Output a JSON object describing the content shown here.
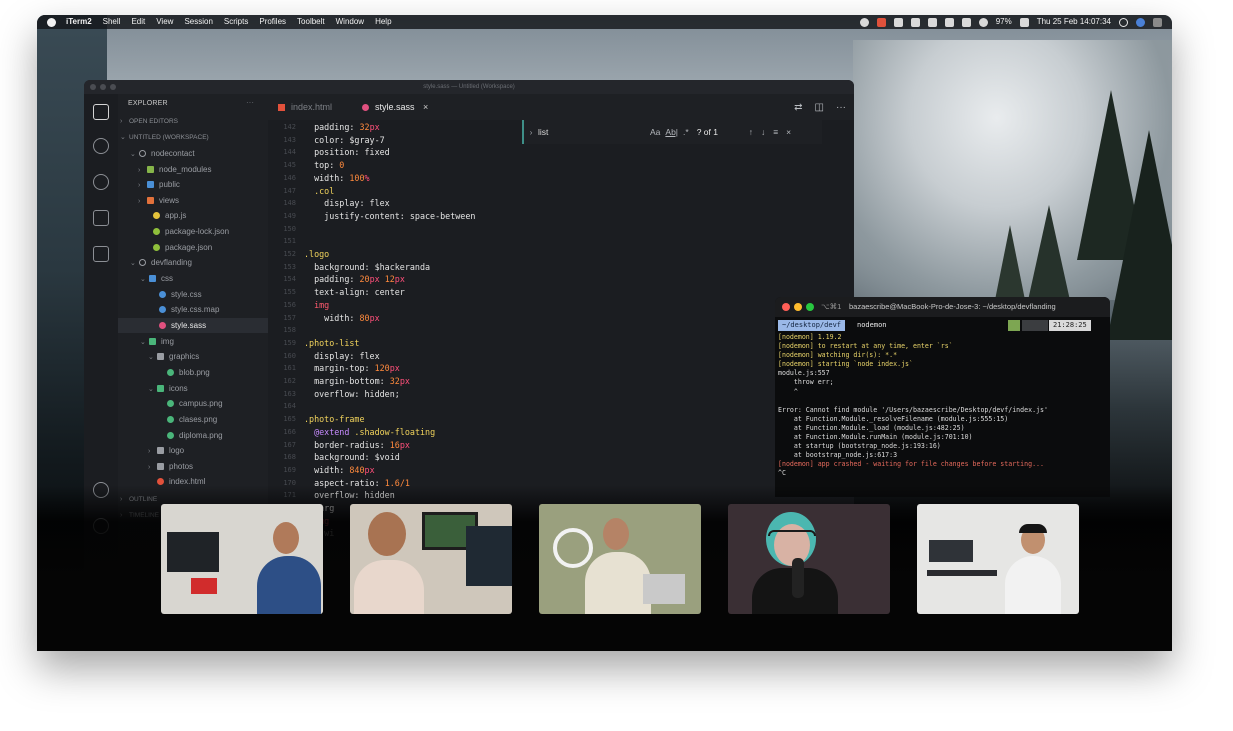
{
  "menubar": {
    "app": "iTerm2",
    "items": [
      "Shell",
      "Edit",
      "View",
      "Session",
      "Scripts",
      "Profiles",
      "Toolbelt",
      "Window",
      "Help"
    ],
    "battery": "97%",
    "clock": "Thu 25 Feb  14:07:34"
  },
  "vscode": {
    "title": "style.sass — Untitled (Workspace)",
    "explorer_label": "EXPLORER",
    "explorer_menu": "···",
    "tree": [
      {
        "label": "OPEN EDITORS",
        "kind": "section",
        "chevron": "›",
        "color": "#8b8e94"
      },
      {
        "label": "UNTITLED (WORKSPACE)",
        "kind": "section",
        "chevron": "⌄",
        "color": "#8b8e94"
      },
      {
        "label": "nodecontact",
        "kind": "root",
        "chevron": "⌄",
        "color": "#9a9da3"
      },
      {
        "label": "node_modules",
        "kind": "folder",
        "chevron": "›",
        "color": "#86b54a"
      },
      {
        "label": "public",
        "kind": "folder",
        "chevron": "›",
        "color": "#4a8fd6"
      },
      {
        "label": "views",
        "kind": "folder",
        "chevron": "›",
        "color": "#e2713b"
      },
      {
        "label": "app.js",
        "kind": "file",
        "chevron": "",
        "color": "#e4c23b"
      },
      {
        "label": "package-lock.json",
        "kind": "file",
        "chevron": "",
        "color": "#8fbf3b"
      },
      {
        "label": "package.json",
        "kind": "file",
        "chevron": "",
        "color": "#8fbf3b"
      },
      {
        "label": "devflanding",
        "kind": "root",
        "chevron": "⌄",
        "color": "#9a9da3"
      },
      {
        "label": "css",
        "kind": "folder",
        "chevron": "⌄",
        "color": "#4a8fd6"
      },
      {
        "label": "style.css",
        "kind": "file",
        "chevron": "",
        "color": "#4a8fd6"
      },
      {
        "label": "style.css.map",
        "kind": "file",
        "chevron": "",
        "color": "#4a8fd6"
      },
      {
        "label": "style.sass",
        "kind": "file",
        "chevron": "",
        "color": "#e0507f"
      },
      {
        "label": "img",
        "kind": "folder",
        "chevron": "⌄",
        "color": "#4ab57a"
      },
      {
        "label": "graphics",
        "kind": "folder",
        "chevron": "⌄",
        "color": "#9a9da3"
      },
      {
        "label": "blob.png",
        "kind": "file",
        "chevron": "",
        "color": "#4ab57a"
      },
      {
        "label": "icons",
        "kind": "folder",
        "chevron": "⌄",
        "color": "#4ab57a"
      },
      {
        "label": "campus.png",
        "kind": "file",
        "chevron": "",
        "color": "#4ab57a"
      },
      {
        "label": "clases.png",
        "kind": "file",
        "chevron": "",
        "color": "#4ab57a"
      },
      {
        "label": "diploma.png",
        "kind": "file",
        "chevron": "",
        "color": "#4ab57a"
      },
      {
        "label": "logo",
        "kind": "folder",
        "chevron": "›",
        "color": "#9a9da3"
      },
      {
        "label": "photos",
        "kind": "folder",
        "chevron": "›",
        "color": "#9a9da3"
      },
      {
        "label": "index.html",
        "kind": "file",
        "chevron": "",
        "color": "#e2513b"
      },
      {
        "label": "OUTLINE",
        "kind": "section",
        "chevron": "›",
        "color": "#6b6e74"
      },
      {
        "label": "TIMELINE",
        "kind": "section",
        "chevron": "›",
        "color": "#6b6e74"
      }
    ],
    "tabs": [
      {
        "label": "index.html",
        "color": "#e2513b",
        "active": false
      },
      {
        "label": "style.sass",
        "color": "#e0507f",
        "active": true
      }
    ],
    "close_glyph": "×",
    "find": {
      "query": "list",
      "aa": "Aa",
      "ab": "Ab|",
      "regex": ".*",
      "count": "? of 1"
    },
    "code": [
      {
        "n": "142",
        "segs": [
          {
            "t": "  padding: ",
            "c": "#e4e4e4"
          },
          {
            "t": "32",
            "c": "#ff8a3d"
          },
          {
            "t": "px",
            "c": "#ff4f7a"
          }
        ]
      },
      {
        "n": "143",
        "segs": [
          {
            "t": "  color: $gray-7",
            "c": "#e4e4e4"
          }
        ]
      },
      {
        "n": "144",
        "segs": [
          {
            "t": "  position: fixed",
            "c": "#e4e4e4"
          }
        ]
      },
      {
        "n": "145",
        "segs": [
          {
            "t": "  top: ",
            "c": "#e4e4e4"
          },
          {
            "t": "0",
            "c": "#ff8a3d"
          }
        ]
      },
      {
        "n": "146",
        "segs": [
          {
            "t": "  width: ",
            "c": "#e4e4e4"
          },
          {
            "t": "100",
            "c": "#ff8a3d"
          },
          {
            "t": "%",
            "c": "#ff4f7a"
          }
        ]
      },
      {
        "n": "147",
        "segs": [
          {
            "t": "  .col",
            "c": "#f1d35c"
          }
        ]
      },
      {
        "n": "148",
        "segs": [
          {
            "t": "    display: flex",
            "c": "#e4e4e4"
          }
        ]
      },
      {
        "n": "149",
        "segs": [
          {
            "t": "    justify-content: space-between",
            "c": "#e4e4e4"
          }
        ]
      },
      {
        "n": "150",
        "segs": []
      },
      {
        "n": "151",
        "segs": []
      },
      {
        "n": "152",
        "segs": [
          {
            "t": ".logo",
            "c": "#f1d35c"
          }
        ]
      },
      {
        "n": "153",
        "segs": [
          {
            "t": "  background: $hackeranda",
            "c": "#e4e4e4"
          }
        ]
      },
      {
        "n": "154",
        "segs": [
          {
            "t": "  padding: ",
            "c": "#e4e4e4"
          },
          {
            "t": "20",
            "c": "#ff8a3d"
          },
          {
            "t": "px ",
            "c": "#ff4f7a"
          },
          {
            "t": "12",
            "c": "#ff8a3d"
          },
          {
            "t": "px",
            "c": "#ff4f7a"
          }
        ]
      },
      {
        "n": "155",
        "segs": [
          {
            "t": "  text-align: center",
            "c": "#e4e4e4"
          }
        ]
      },
      {
        "n": "156",
        "segs": [
          {
            "t": "  img",
            "c": "#ff5a6e"
          }
        ]
      },
      {
        "n": "157",
        "segs": [
          {
            "t": "    width: ",
            "c": "#e4e4e4"
          },
          {
            "t": "80",
            "c": "#ff8a3d"
          },
          {
            "t": "px",
            "c": "#ff4f7a"
          }
        ]
      },
      {
        "n": "158",
        "segs": []
      },
      {
        "n": "159",
        "segs": [
          {
            "t": ".photo-list",
            "c": "#f1d35c"
          }
        ]
      },
      {
        "n": "160",
        "segs": [
          {
            "t": "  display: flex",
            "c": "#e4e4e4"
          }
        ]
      },
      {
        "n": "161",
        "segs": [
          {
            "t": "  margin-top: ",
            "c": "#e4e4e4"
          },
          {
            "t": "120",
            "c": "#ff8a3d"
          },
          {
            "t": "px",
            "c": "#ff4f7a"
          }
        ]
      },
      {
        "n": "162",
        "segs": [
          {
            "t": "  margin-bottom: ",
            "c": "#e4e4e4"
          },
          {
            "t": "32",
            "c": "#ff8a3d"
          },
          {
            "t": "px",
            "c": "#ff4f7a"
          }
        ]
      },
      {
        "n": "163",
        "segs": [
          {
            "t": "  overflow: hidden;",
            "c": "#e4e4e4"
          }
        ]
      },
      {
        "n": "164",
        "segs": []
      },
      {
        "n": "165",
        "segs": [
          {
            "t": ".photo-frame",
            "c": "#f1d35c"
          }
        ]
      },
      {
        "n": "166",
        "segs": [
          {
            "t": "  @extend",
            "c": "#c78bff"
          },
          {
            "t": " .shadow-floating",
            "c": "#f1d35c"
          }
        ]
      },
      {
        "n": "167",
        "segs": [
          {
            "t": "  border-radius: ",
            "c": "#e4e4e4"
          },
          {
            "t": "16",
            "c": "#ff8a3d"
          },
          {
            "t": "px",
            "c": "#ff4f7a"
          }
        ]
      },
      {
        "n": "168",
        "segs": [
          {
            "t": "  background: $void",
            "c": "#e4e4e4"
          }
        ]
      },
      {
        "n": "169",
        "segs": [
          {
            "t": "  width: ",
            "c": "#e4e4e4"
          },
          {
            "t": "840",
            "c": "#ff8a3d"
          },
          {
            "t": "px",
            "c": "#ff4f7a"
          }
        ]
      },
      {
        "n": "170",
        "segs": [
          {
            "t": "  aspect-ratio: ",
            "c": "#e4e4e4"
          },
          {
            "t": "1.6/1",
            "c": "#ff8a3d"
          }
        ]
      },
      {
        "n": "171",
        "segs": [
          {
            "t": "  overflow: hidden",
            "c": "#e4e4e4"
          }
        ]
      },
      {
        "n": "172",
        "segs": [
          {
            "t": "  marg",
            "c": "#e4e4e4"
          }
        ]
      },
      {
        "n": "173",
        "segs": [
          {
            "t": "  img",
            "c": "#ff5a6e"
          }
        ]
      },
      {
        "n": "174",
        "segs": [
          {
            "t": "    wi",
            "c": "#e4e4e4"
          }
        ]
      }
    ]
  },
  "iterm": {
    "title": "bazaescribe@MacBook-Pro-de-Jose-3: ~/desktop/devflanding",
    "shortcut": "⌥⌘1",
    "prompt_dir": "~/desktop/devf",
    "prompt_cmd": "nodemon",
    "clock": "21:28:25",
    "lines": [
      {
        "t": "[nodemon] 1.19.2",
        "c": "yellow"
      },
      {
        "t": "[nodemon] to restart at any time, enter `rs`",
        "c": "yellow"
      },
      {
        "t": "[nodemon] watching dir(s): *.*",
        "c": "yellow"
      },
      {
        "t": "[nodemon] starting `node index.js`",
        "c": "yellow"
      },
      {
        "t": "module.js:557",
        "c": "white"
      },
      {
        "t": "    throw err;",
        "c": "white"
      },
      {
        "t": "    ^",
        "c": "white"
      },
      {
        "t": "",
        "c": "white"
      },
      {
        "t": "Error: Cannot find module '/Users/bazaescribe/Desktop/devf/index.js'",
        "c": "white"
      },
      {
        "t": "    at Function.Module._resolveFilename (module.js:555:15)",
        "c": "white"
      },
      {
        "t": "    at Function.Module._load (module.js:482:25)",
        "c": "white"
      },
      {
        "t": "    at Function.Module.runMain (module.js:701:10)",
        "c": "white"
      },
      {
        "t": "    at startup (bootstrap_node.js:193:16)",
        "c": "white"
      },
      {
        "t": "    at bootstrap_node.js:617:3",
        "c": "white"
      },
      {
        "t": "[nodemon] app crashed - waiting for file changes before starting...",
        "c": "red"
      },
      {
        "t": "^C",
        "c": "white"
      }
    ]
  },
  "webcams": [
    {
      "tones": {
        "bg": "#d8d6d0",
        "accent": "#2b3542",
        "skin": "#b07a5a",
        "shirt": "#2d4f86"
      }
    },
    {
      "tones": {
        "bg": "#cfc7bb",
        "accent": "#3a3f4a",
        "skin": "#a87352",
        "shirt": "#e8d7cc"
      }
    },
    {
      "tones": {
        "bg": "#9aa07e",
        "accent": "#6f7a4a",
        "skin": "#b58366",
        "shirt": "#e7e1d2"
      }
    },
    {
      "tones": {
        "bg": "#3a2f34",
        "accent": "#1e1b20",
        "skin": "#d8b2a4",
        "shirt": "#141414"
      }
    },
    {
      "tones": {
        "bg": "#e6e6e4",
        "accent": "#2a2b2f",
        "skin": "#c1906f",
        "shirt": "#f2f2f2"
      }
    }
  ]
}
